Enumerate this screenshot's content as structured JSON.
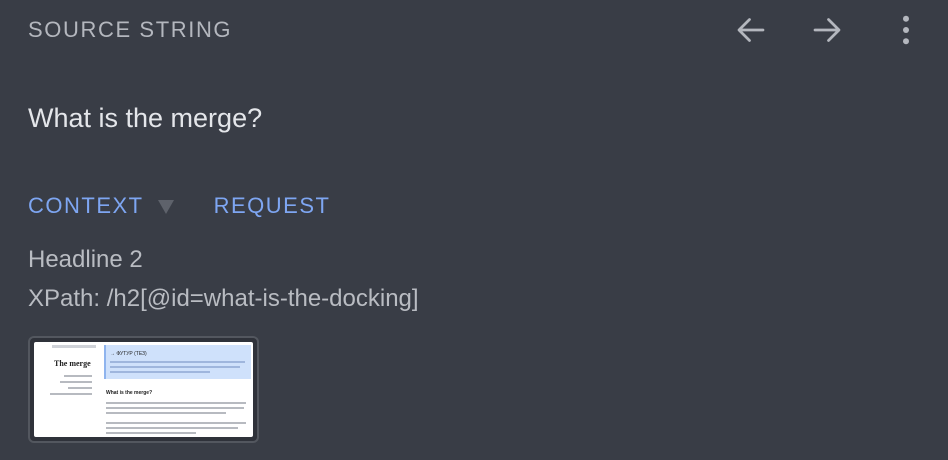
{
  "header": {
    "title": "SOURCE STRING",
    "icons": [
      "back-arrow-icon",
      "forward-arrow-icon",
      "more-vertical-icon"
    ]
  },
  "source": {
    "text": "What is the merge?"
  },
  "tabs": {
    "context_label": "CONTEXT",
    "request_label": "REQUEST"
  },
  "context": {
    "element_type": "Headline 2",
    "xpath": "XPath: /h2[@id=what-is-the-docking]"
  },
  "thumbnail": {
    "page_title": "The merge",
    "callout_title": "→ ФУТУР (ТЕЗ)",
    "section_heading": "What is the merge?"
  },
  "colors": {
    "background": "#393d46",
    "accent": "#7ea6f2",
    "muted_text": "#b4b7be"
  }
}
